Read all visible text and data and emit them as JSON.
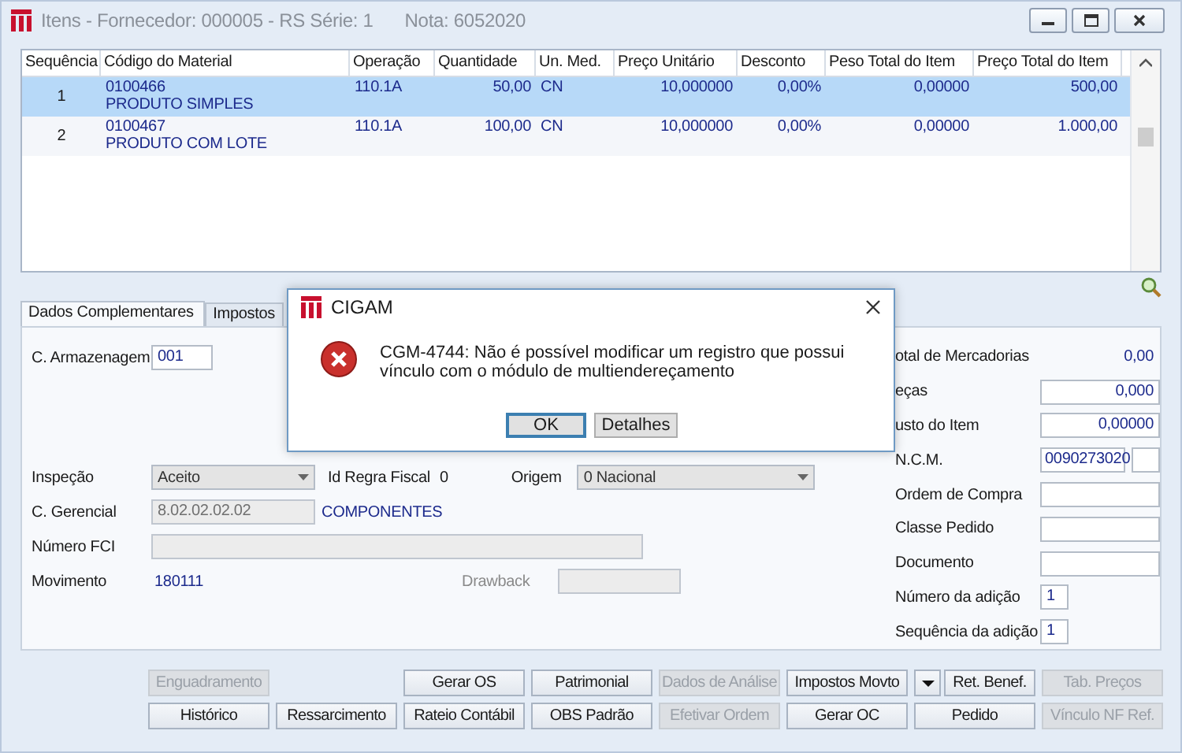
{
  "window": {
    "title": "Itens - Fornecedor: 000005 - RS Série: 1",
    "subtitle": "Nota: 6052020"
  },
  "table": {
    "columns": [
      "Sequência",
      "Código do Material",
      "Operação",
      "Quantidade",
      "Un. Med.",
      "Preço Unitário",
      "Desconto",
      "Peso Total do Item",
      "Preço Total do Item"
    ],
    "rows": [
      {
        "selected": true,
        "cells": [
          "1",
          "0100466",
          "110.1A",
          "50,00",
          "CN",
          "10,000000",
          "0,00%",
          "0,00000",
          "500,00"
        ],
        "description": "PRODUTO SIMPLES"
      },
      {
        "selected": false,
        "cells": [
          "2",
          "0100467",
          "110.1A",
          "100,00",
          "CN",
          "10,000000",
          "0,00%",
          "0,00000",
          "1.000,00"
        ],
        "description": "PRODUTO COM LOTE"
      }
    ]
  },
  "tabs": [
    {
      "label": "Dados Complementares",
      "selected": true
    },
    {
      "label": "Impostos",
      "selected": false
    }
  ],
  "form": {
    "left": [
      [
        {
          "kind": "label",
          "text": "C. Armazenagem"
        },
        {
          "kind": "input",
          "value": "001",
          "disabled": false
        }
      ],
      [
        {
          "kind": "label",
          "text": "Inspeção"
        },
        {
          "kind": "select",
          "value": "Aceito",
          "disabled": true
        },
        {
          "kind": "label",
          "text": "Id Regra Fiscal"
        },
        {
          "kind": "value",
          "text": "0"
        },
        {
          "kind": "label",
          "text": "Origem"
        },
        {
          "kind": "select",
          "value": "0 Nacional",
          "disabled": true
        }
      ],
      [
        {
          "kind": "label",
          "text": "C. Gerencial"
        },
        {
          "kind": "input",
          "value": "8.02.02.02.02",
          "disabled": true
        },
        {
          "kind": "link",
          "text": "COMPONENTES"
        }
      ],
      [
        {
          "kind": "label",
          "text": "Número FCI"
        },
        {
          "kind": "input",
          "disabled": true
        }
      ],
      [
        {
          "kind": "label",
          "text": "Movimento"
        },
        {
          "kind": "link",
          "text": "180111"
        },
        {
          "kind": "dim-label",
          "text": "Drawback"
        },
        {
          "kind": "input",
          "disabled": true
        }
      ]
    ],
    "right": [
      {
        "kind": "value",
        "label": "otal de Mercadorias",
        "value": "0,00"
      },
      {
        "kind": "input",
        "label": "eças",
        "value": "0,000"
      },
      {
        "kind": "input",
        "label": "usto do Item",
        "value": "0,00000"
      },
      {
        "kind": "input-pair",
        "label": "N.C.M.",
        "value": "0090273020"
      },
      {
        "kind": "input",
        "label": "Ordem de Compra"
      },
      {
        "kind": "input",
        "label": "Classe Pedido"
      },
      {
        "kind": "input",
        "label": "Documento"
      },
      {
        "kind": "small-input",
        "label": "Número da adição",
        "value": "1"
      },
      {
        "kind": "small-input",
        "label": "Sequência da adição",
        "value": "1"
      }
    ]
  },
  "buttons": [
    [
      {
        "kind": "button",
        "label": "Enguadramento",
        "disabled": true
      },
      {
        "kind": "button",
        "label": "Gerar OS",
        "disabled": false
      },
      {
        "kind": "button",
        "label": "Patrimonial",
        "disabled": false
      },
      {
        "kind": "button",
        "label": "Dados de Análise",
        "disabled": true
      },
      {
        "kind": "button",
        "label": "Impostos Movto",
        "disabled": false
      },
      {
        "kind": "arrow",
        "disabled": false
      },
      {
        "kind": "button",
        "label": "Ret. Benef.",
        "disabled": false
      },
      {
        "kind": "button",
        "label": "Tab. Preços",
        "disabled": true
      }
    ],
    [
      {
        "kind": "button",
        "label": "Histórico",
        "disabled": false
      },
      {
        "kind": "button",
        "label": "Ressarcimento",
        "disabled": false
      },
      {
        "kind": "button",
        "label": "Rateio Contábil",
        "disabled": false
      },
      {
        "kind": "button",
        "label": "OBS Padrão",
        "disabled": false
      },
      {
        "kind": "button",
        "label": "Efetivar Ordem",
        "disabled": true
      },
      {
        "kind": "button",
        "label": "Gerar OC",
        "disabled": false
      },
      {
        "kind": "button",
        "label": "Pedido",
        "disabled": false
      },
      {
        "kind": "button",
        "label": "Vínculo NF Ref.",
        "disabled": true
      }
    ]
  ],
  "dialog": {
    "title": "CIGAM",
    "message": "CGM-4744: Não é possível modificar um registro que possui vínculo com o módulo de multiendereçamento",
    "buttons": [
      {
        "label": "OK",
        "default": true
      },
      {
        "label": "Detalhes",
        "default": false
      }
    ]
  }
}
